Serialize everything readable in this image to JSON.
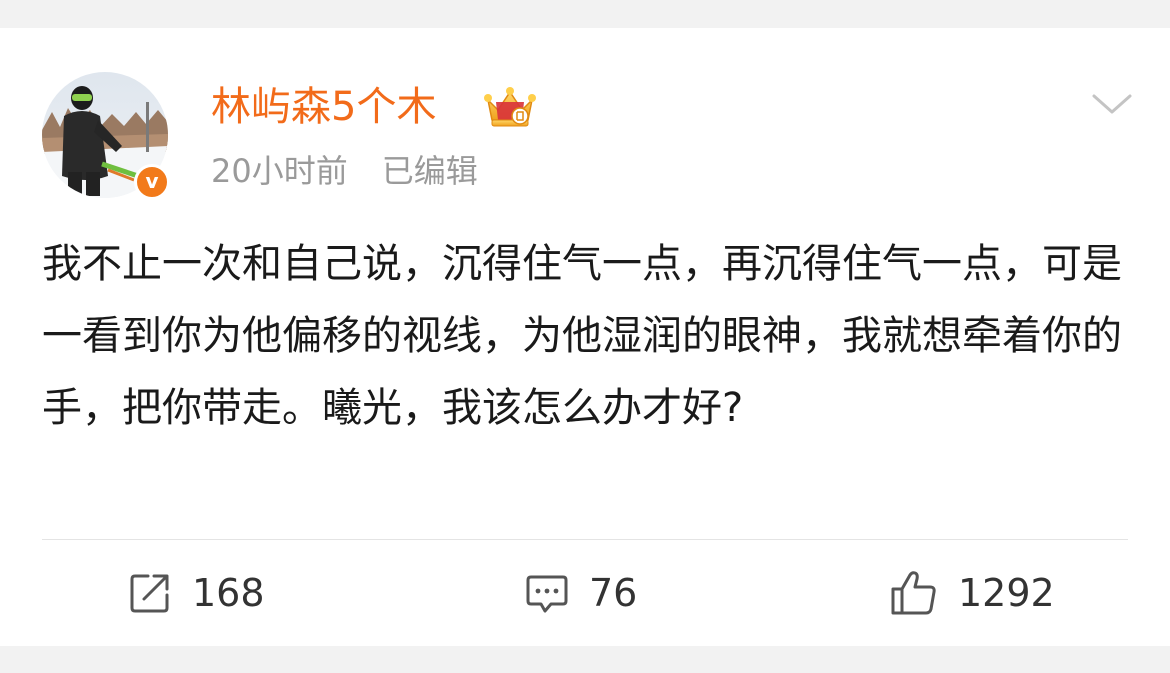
{
  "post": {
    "author": {
      "name": "林屿森5个木",
      "verified": true,
      "verified_badge": "v"
    },
    "time": "20小时前",
    "edited_label": "已编辑",
    "text": "我不止一次和自己说，沉得住气一点，再沉得住气一点，可是一看到你为他偏移的视线，为他湿润的眼神，我就想牵着你的手，把你带走。曦光，我该怎么办才好?"
  },
  "actions": {
    "repost": {
      "icon": "share-icon",
      "count": "168"
    },
    "comment": {
      "icon": "comment-icon",
      "count": "76"
    },
    "like": {
      "icon": "thumbs-up-icon",
      "count": "1292"
    }
  },
  "colors": {
    "username": "#f26b1a",
    "badge": "#f27a1a",
    "meta": "#9a9a9a",
    "text": "#1a1a1a",
    "background": "#f2f2f2"
  }
}
